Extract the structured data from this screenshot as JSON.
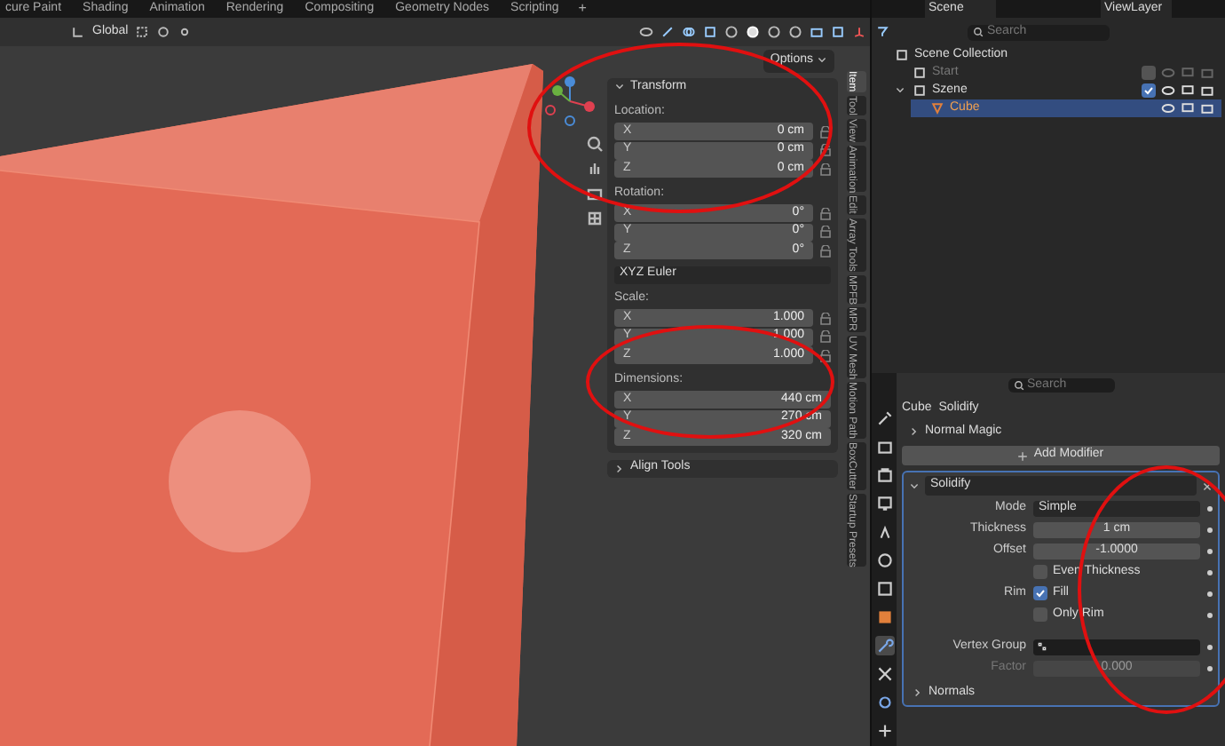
{
  "workspace_tabs": [
    {
      "label": "cure Paint",
      "selected": false
    },
    {
      "label": "Shading",
      "selected": false
    },
    {
      "label": "Animation",
      "selected": false
    },
    {
      "label": "Rendering",
      "selected": false
    },
    {
      "label": "Compositing",
      "selected": false
    },
    {
      "label": "Geometry Nodes",
      "selected": false
    },
    {
      "label": "Scripting",
      "selected": false
    }
  ],
  "add_tab": "+",
  "header": {
    "orientation": "Global"
  },
  "viewport": {
    "options": "Options"
  },
  "transform": {
    "title": "Transform",
    "sections": [
      {
        "kind": "vector",
        "label": "Location:",
        "locked": false,
        "rows": [
          {
            "axis": "X",
            "value": "0 cm"
          },
          {
            "axis": "Y",
            "value": "0 cm"
          },
          {
            "axis": "Z",
            "value": "0 cm"
          }
        ]
      },
      {
        "kind": "vector",
        "label": "Rotation:",
        "locked": false,
        "rows": [
          {
            "axis": "X",
            "value": "0°"
          },
          {
            "axis": "Y",
            "value": "0°"
          },
          {
            "axis": "Z",
            "value": "0°"
          }
        ]
      },
      {
        "kind": "select",
        "value": "XYZ Euler"
      },
      {
        "kind": "vector",
        "label": "Scale:",
        "locked": false,
        "rows": [
          {
            "axis": "X",
            "value": "1.000"
          },
          {
            "axis": "Y",
            "value": "1.000"
          },
          {
            "axis": "Z",
            "value": "1.000"
          }
        ]
      },
      {
        "kind": "dims",
        "label": "Dimensions:",
        "rows": [
          {
            "axis": "X",
            "value": "440 cm"
          },
          {
            "axis": "Y",
            "value": "270 cm"
          },
          {
            "axis": "Z",
            "value": "320 cm"
          }
        ]
      }
    ],
    "collapsed_panel": "Align Tools"
  },
  "sidebar_tabs": [
    {
      "label": "Item",
      "selected": true
    },
    {
      "label": "Tool",
      "selected": false
    },
    {
      "label": "View",
      "selected": false
    },
    {
      "label": "Animation",
      "selected": false
    },
    {
      "label": "Edit",
      "selected": false
    },
    {
      "label": "Array Tools",
      "selected": false
    },
    {
      "label": "MPFB",
      "selected": false
    },
    {
      "label": "MPR",
      "selected": false
    },
    {
      "label": "UV Mesh",
      "selected": false
    },
    {
      "label": "Motion Path",
      "selected": false
    },
    {
      "label": "BoxCutter",
      "selected": false
    },
    {
      "label": "Startup Presets",
      "selected": false
    }
  ],
  "outliner": {
    "scene": "Scene",
    "view_layer": "ViewLayer",
    "search": {
      "placeholder": "Search"
    },
    "items": [
      {
        "label": "Scene Collection",
        "kind": "root",
        "selected": false,
        "excluded": false,
        "children": [
          {
            "label": "Start",
            "kind": "collection",
            "selected": false,
            "excluded": true
          },
          {
            "label": "Szene",
            "kind": "collection",
            "selected": false,
            "excluded": false,
            "expanded": true,
            "children": [
              {
                "label": "Cube",
                "kind": "object",
                "selected": true,
                "excluded": false
              }
            ]
          }
        ]
      }
    ]
  },
  "properties": {
    "search": {
      "placeholder": "Search"
    },
    "tabs": [
      {
        "kind": "tool",
        "selected": false
      },
      {
        "kind": "render",
        "selected": false
      },
      {
        "kind": "output",
        "selected": false
      },
      {
        "kind": "view",
        "selected": false
      },
      {
        "kind": "scene",
        "selected": false
      },
      {
        "kind": "world",
        "selected": false
      },
      {
        "kind": "collection",
        "selected": false
      },
      {
        "kind": "object",
        "selected": false
      },
      {
        "kind": "modifier",
        "selected": true
      },
      {
        "kind": "particles",
        "selected": false
      },
      {
        "kind": "physics",
        "selected": false
      },
      {
        "kind": "constraints",
        "selected": false
      }
    ],
    "breadcrumb": [
      "Cube",
      "Solidify"
    ],
    "collapsed_modifier": "Normal Magic",
    "add_modifier": "Add Modifier",
    "modifier": {
      "name": "Solidify",
      "rows": [
        {
          "kind": "select",
          "label": "Mode",
          "value": "Simple",
          "disabled": false
        },
        {
          "kind": "number",
          "label": "Thickness",
          "value": "1 cm",
          "disabled": false
        },
        {
          "kind": "number",
          "label": "Offset",
          "value": "-1.0000",
          "disabled": false
        },
        {
          "kind": "check",
          "label": "",
          "text": "Even Thickness",
          "checked": false,
          "disabled": false
        },
        {
          "kind": "check",
          "label": "Rim",
          "text": "Fill",
          "checked": true,
          "disabled": false
        },
        {
          "kind": "check",
          "label": "",
          "text": "Only Rim",
          "checked": false,
          "disabled": false
        },
        {
          "kind": "group",
          "label": "Vertex Group",
          "disabled": false
        },
        {
          "kind": "number",
          "label": "Factor",
          "value": "0.000",
          "disabled": true
        }
      ],
      "subpanel": "Normals"
    }
  }
}
